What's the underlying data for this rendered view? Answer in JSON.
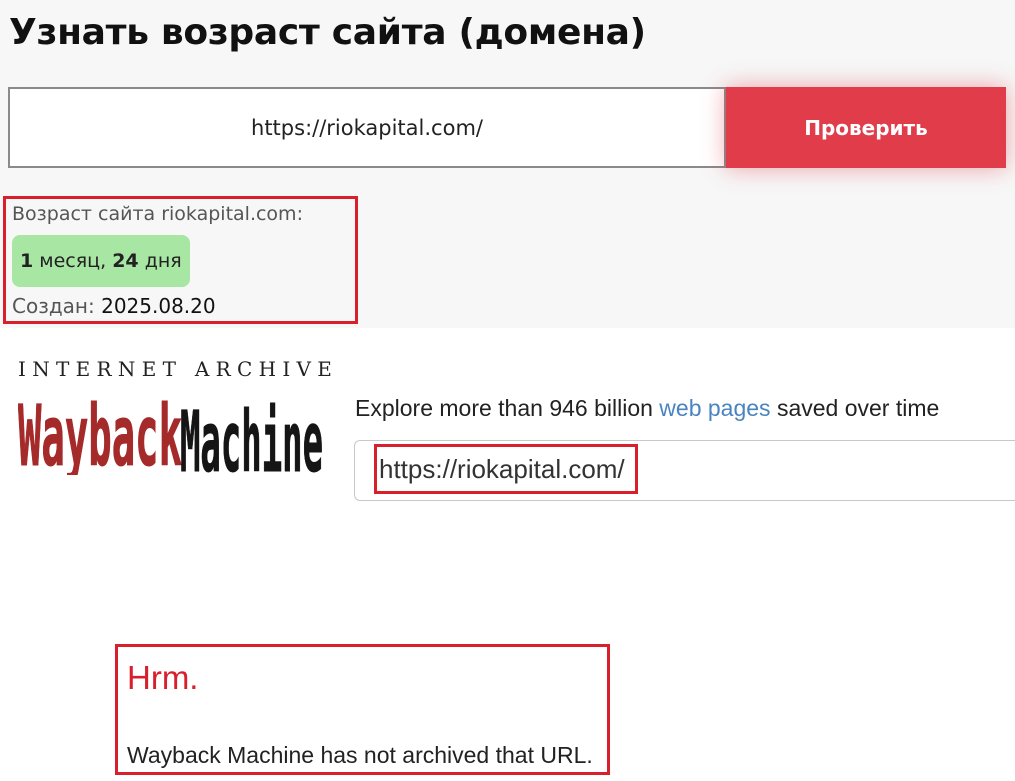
{
  "checker": {
    "title": "Узнать возраст сайта (домена)",
    "url_value": "https://riokapital.com/",
    "check_button_label": "Проверить",
    "accent_color": "#e13c4a",
    "result": {
      "age_label": "Возраст сайта riokapital.com:",
      "age_months": "1",
      "age_months_word": "месяц,",
      "age_days": "24",
      "age_days_word": "дня",
      "badge_color": "#a8e6a3",
      "created_label": "Создан:",
      "created_value": "2025.08.20"
    }
  },
  "wayback": {
    "brand_top": "INTERNET ARCHIVE",
    "logo_word_1": "Wayback",
    "logo_word_2": "Machine",
    "explore_prefix": "Explore more than 946 billion",
    "explore_link": "web pages",
    "explore_suffix": "saved over time",
    "search_value": "https://riokapital.com/",
    "error_title": "Hrm.",
    "error_message": "Wayback Machine has not archived that URL.",
    "logo_red": "#a52a2a"
  },
  "highlight_color": "#d7202c"
}
